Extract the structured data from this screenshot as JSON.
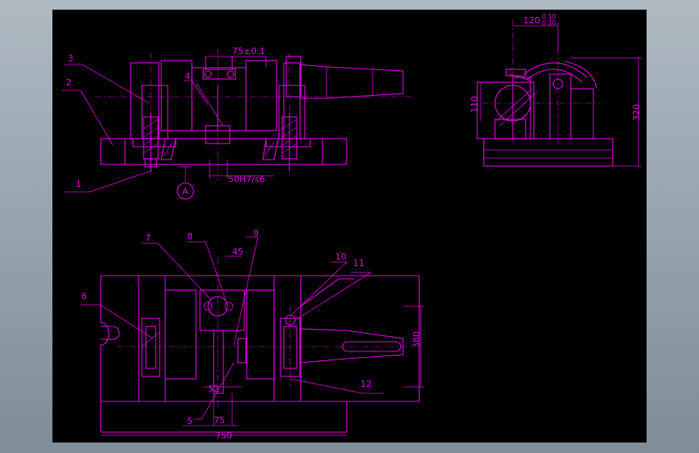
{
  "colors": {
    "background": "#000000",
    "line": "#e000e0",
    "frame": "#9aa6b0"
  },
  "front_view": {
    "dim_top": "75±0.1",
    "dim_fit": "50H7/s6",
    "section_mark": "A",
    "part_labels": {
      "p1": "1",
      "p2": "2",
      "p3": "3",
      "p4": "4"
    }
  },
  "side_view": {
    "dim_top": "120",
    "dim_top_tol_upper": "0.10",
    "dim_top_tol_lower": "0.10",
    "dim_left": "110",
    "dim_right": "320"
  },
  "top_view": {
    "part_labels": {
      "p5": "5",
      "p6": "6",
      "p7": "7",
      "p8": "8",
      "p9": "9",
      "p10": "10",
      "p11": "11",
      "p12": "12"
    },
    "dim_45": "45",
    "dim_52": "52",
    "dim_75": "75",
    "dim_750": "750",
    "dim_380": "380"
  }
}
